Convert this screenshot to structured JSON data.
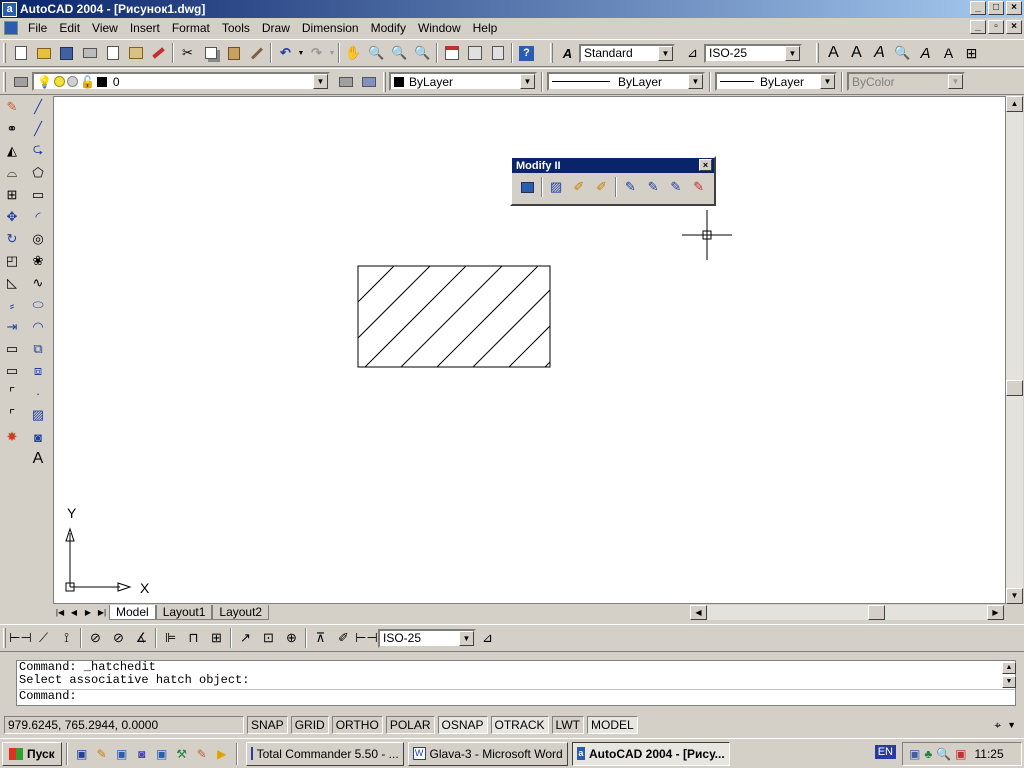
{
  "window": {
    "title": "AutoCAD 2004 - [Рисунок1.dwg]",
    "app_icon": "a",
    "min_glyph": "_",
    "max_glyph": "□",
    "close_glyph": "×",
    "restore_glyph": "▫"
  },
  "menu": [
    "File",
    "Edit",
    "View",
    "Insert",
    "Format",
    "Tools",
    "Draw",
    "Dimension",
    "Modify",
    "Window",
    "Help"
  ],
  "standard_toolbar": {
    "icons": [
      "new-icon",
      "open-icon",
      "save-icon",
      "print-icon",
      "print-preview-icon",
      "publish-icon",
      "plot-icon",
      "cut-icon",
      "copy-icon",
      "paste-icon",
      "match-properties-icon",
      "undo-icon",
      "redo-icon",
      "pan-icon",
      "zoom-realtime-icon",
      "zoom-window-icon",
      "zoom-previous-icon",
      "properties-icon",
      "design-center-icon",
      "tool-palettes-icon",
      "help-icon"
    ]
  },
  "styles_toolbar": {
    "text_style": "Standard",
    "dim_style": "ISO-25"
  },
  "layers_toolbar": {
    "layer_value": "0"
  },
  "properties_toolbar": {
    "color": "ByLayer",
    "linetype": "ByLayer",
    "lineweight": "ByLayer",
    "plotstyle": "ByColor"
  },
  "modify2": {
    "title": "Modify II",
    "close_glyph": "×"
  },
  "ucs": {
    "x_label": "X",
    "y_label": "Y"
  },
  "tabs": [
    "Model",
    "Layout1",
    "Layout2"
  ],
  "dim_toolbar": {
    "dim_style": "ISO-25"
  },
  "command": {
    "line1": "Command:  _hatchedit",
    "line2": "Select associative hatch object:",
    "prompt": "Command:"
  },
  "status": {
    "coords": "979.6245, 765.2944, 0.0000",
    "buttons": [
      "SNAP",
      "GRID",
      "ORTHO",
      "POLAR",
      "OSNAP",
      "OTRACK",
      "LWT",
      "MODEL"
    ]
  },
  "taskbar": {
    "start": "Пуск",
    "tasks": [
      "Total Commander 5.50 - ...",
      "Glava-3 - Microsoft Word",
      "AutoCAD 2004 - [Рису..."
    ],
    "lang": "EN",
    "time": "11:25"
  },
  "colors": {
    "title_start": "#0a246a",
    "title_end": "#a6caf0",
    "face": "#d4d0c8"
  }
}
